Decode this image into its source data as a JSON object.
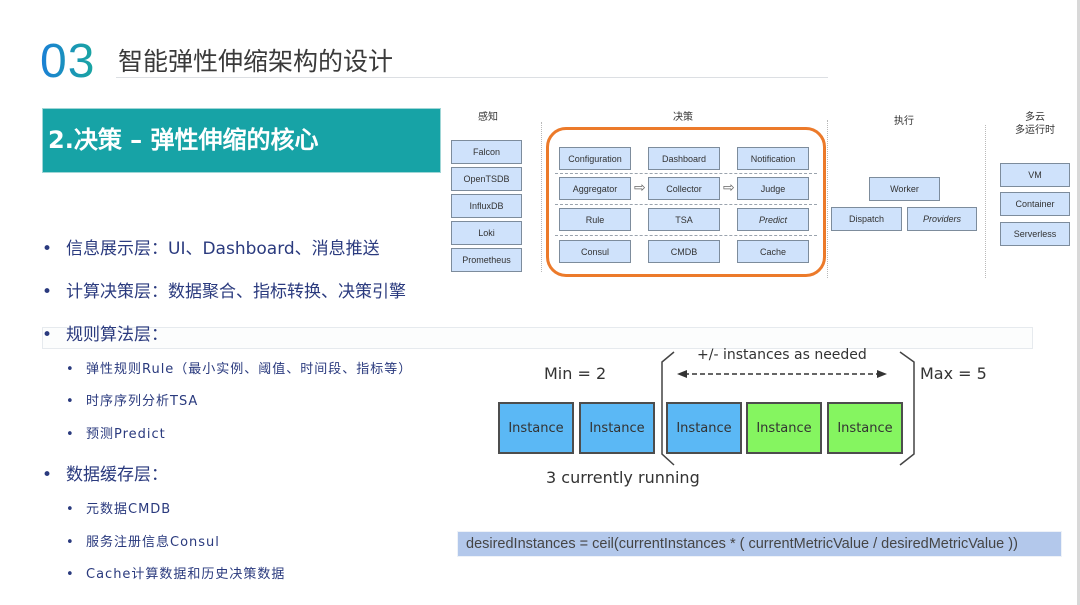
{
  "header": {
    "section_number": "03",
    "title": "智能弹性伸缩架构的设计"
  },
  "banner": {
    "title": "2.决策 – 弹性伸缩的核心"
  },
  "bullets": [
    {
      "level": 1,
      "text": "信息展示层：UI、Dashboard、消息推送"
    },
    {
      "level": 1,
      "text": "计算决策层：数据聚合、指标转换、决策引擎"
    },
    {
      "level": 1,
      "text": "规则算法层："
    },
    {
      "level": 2,
      "text": "弹性规则Rule（最小实例、阈值、时间段、指标等）"
    },
    {
      "level": 2,
      "text": "时序序列分析TSA"
    },
    {
      "level": 2,
      "text": "预测Predict"
    },
    {
      "level": 1,
      "text": "数据缓存层："
    },
    {
      "level": 2,
      "text": "元数据CMDB"
    },
    {
      "level": 2,
      "text": "服务注册信息Consul"
    },
    {
      "level": 2,
      "text": "Cache计算数据和历史决策数据"
    }
  ],
  "bullet_glyph": "•",
  "architecture": {
    "columns": {
      "perception": {
        "title": "感知",
        "nodes": [
          "Falcon",
          "OpenTSDB",
          "InfluxDB",
          "Loki",
          "Prometheus"
        ]
      },
      "decision": {
        "title": "决策",
        "rows": [
          [
            "Configuration",
            "Dashboard",
            "Notification"
          ],
          [
            "Aggregator",
            "Collector",
            "Judge"
          ],
          [
            "Rule",
            "TSA",
            "Predict"
          ],
          [
            "Consul",
            "CMDB",
            "Cache"
          ]
        ],
        "arrow_glyph": "⇨"
      },
      "execution": {
        "title": "执行",
        "nodes": [
          "Worker",
          "Dispatch",
          "Providers"
        ]
      },
      "multicloud": {
        "title_line1": "多云",
        "title_line2": "多运行时",
        "nodes": [
          "VM",
          "Container",
          "Serverless"
        ]
      }
    }
  },
  "scaling": {
    "min_label": "Min = 2",
    "max_label": "Max = 5",
    "range_label": "+/- instances as needed",
    "running_label": "3 currently running",
    "instance_label": "Instance",
    "instances": [
      {
        "state": "running",
        "color": "#5bb8f5"
      },
      {
        "state": "running",
        "color": "#5bb8f5"
      },
      {
        "state": "running",
        "color": "#5bb8f5"
      },
      {
        "state": "available",
        "color": "#85f560"
      },
      {
        "state": "available",
        "color": "#85f560"
      }
    ]
  },
  "formula": "desiredInstances = ceil(currentInstances * ( currentMetricValue / desiredMetricValue ))",
  "colors": {
    "teal_banner": "#17a3a6",
    "orange_frame": "#ec7a2a",
    "node_fill": "#cfe2fb",
    "bullet_text": "#2a3a7e",
    "formula_bg": "#b3c8eb"
  }
}
